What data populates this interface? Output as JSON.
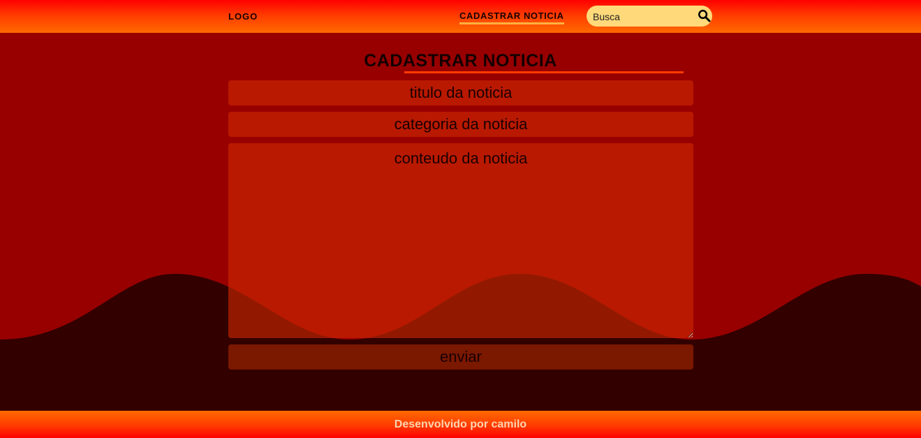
{
  "header": {
    "logo": "LOGO",
    "nav_link": "CADASTRAR NOTICIA",
    "search_placeholder": "Busca",
    "search_icon": "search-icon"
  },
  "form": {
    "title": "CADASTRAR NOTICIA",
    "title_placeholder": "titulo da noticia",
    "category_placeholder": "categoria da noticia",
    "content_placeholder": "conteudo da noticia",
    "submit_label": "enviar"
  },
  "footer": {
    "text": "Desenvolvido por camilo"
  },
  "colors": {
    "background": "#980000",
    "header_gradient_top": "#ff0000",
    "header_gradient_bottom": "#ff6a00",
    "search_background": "#ffd97a",
    "wave": "#330000",
    "accent_underline": "#ff3b00"
  }
}
